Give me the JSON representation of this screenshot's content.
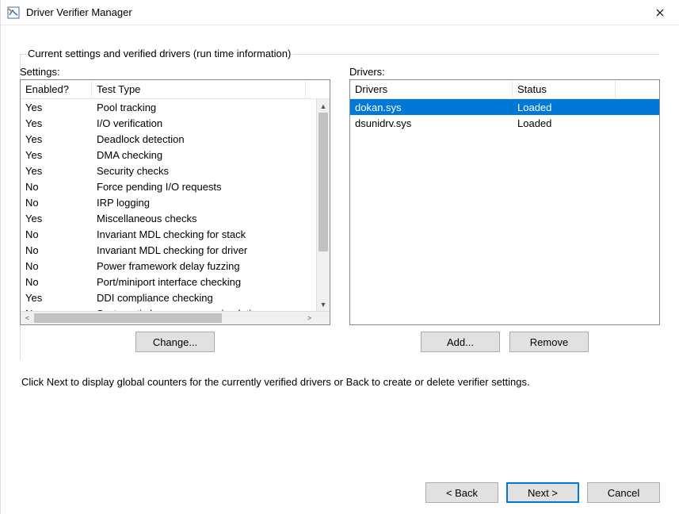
{
  "window": {
    "title": "Driver Verifier Manager"
  },
  "groupbox": {
    "label": "Current settings and verified drivers (run time information)"
  },
  "settings": {
    "label": "Settings:",
    "columns": {
      "enabled": "Enabled?",
      "test": "Test Type"
    },
    "rows": [
      {
        "enabled": "Yes",
        "test": "Pool tracking"
      },
      {
        "enabled": "Yes",
        "test": "I/O verification"
      },
      {
        "enabled": "Yes",
        "test": "Deadlock detection"
      },
      {
        "enabled": "Yes",
        "test": "DMA checking"
      },
      {
        "enabled": "Yes",
        "test": "Security checks"
      },
      {
        "enabled": "No",
        "test": "Force pending I/O requests"
      },
      {
        "enabled": "No",
        "test": "IRP logging"
      },
      {
        "enabled": "Yes",
        "test": "Miscellaneous checks"
      },
      {
        "enabled": "No",
        "test": "Invariant MDL checking for stack"
      },
      {
        "enabled": "No",
        "test": "Invariant MDL checking for driver"
      },
      {
        "enabled": "No",
        "test": "Power framework delay fuzzing"
      },
      {
        "enabled": "No",
        "test": "Port/miniport interface checking"
      },
      {
        "enabled": "Yes",
        "test": "DDI compliance checking"
      },
      {
        "enabled": "No",
        "test": "Systematic low resources simulation"
      }
    ],
    "change_button": "Change..."
  },
  "drivers": {
    "label": "Drivers:",
    "columns": {
      "driver": "Drivers",
      "status": "Status"
    },
    "rows": [
      {
        "driver": "dokan.sys",
        "status": "Loaded",
        "selected": true
      },
      {
        "driver": "dsunidrv.sys",
        "status": "Loaded",
        "selected": false
      }
    ],
    "add_button": "Add...",
    "remove_button": "Remove"
  },
  "hint": "Click Next to display global counters for the currently verified drivers or Back to create or delete verifier settings.",
  "footer": {
    "back": "< Back",
    "next": "Next >",
    "cancel": "Cancel"
  }
}
